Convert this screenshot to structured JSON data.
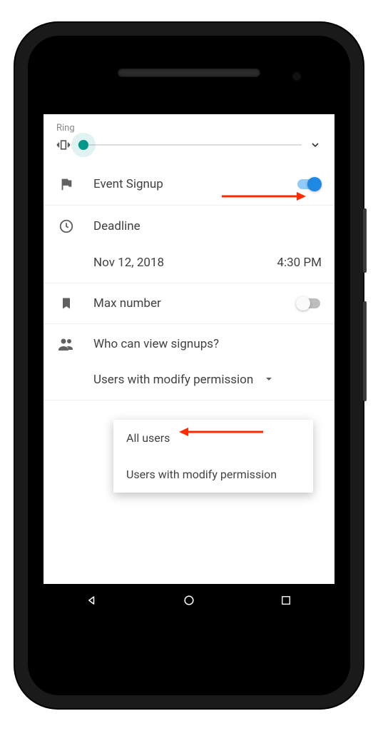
{
  "ring": {
    "label": "Ring"
  },
  "eventSignup": {
    "label": "Event Signup",
    "enabled": true
  },
  "deadline": {
    "label": "Deadline",
    "date": "Nov 12, 2018",
    "time": "4:30 PM"
  },
  "maxNumber": {
    "label": "Max number",
    "enabled": false
  },
  "viewSignups": {
    "label": "Who can view signups?",
    "selected": "Users with modify permission",
    "options": [
      "All users",
      "Users with modify permission"
    ]
  }
}
